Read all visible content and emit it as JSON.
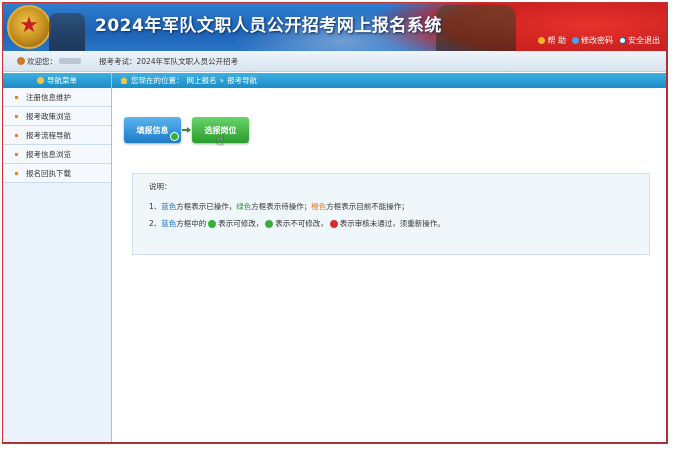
{
  "header": {
    "title": "2024年军队文职人员公开招考网上报名系统",
    "links": [
      {
        "label": "帮 助",
        "icon": "help-icon",
        "color": "#f5b81f"
      },
      {
        "label": "修改密码",
        "icon": "key-icon",
        "color": "#3fa8f0"
      },
      {
        "label": "安全退出",
        "icon": "exit-icon",
        "color": "#ffffff"
      }
    ]
  },
  "infobar": {
    "welcome": "欢迎您：",
    "exam": "报考考试：2024年军队文职人员公开招考"
  },
  "sidebar": {
    "title": "导航菜单",
    "items": [
      {
        "label": "注册信息维护"
      },
      {
        "label": "报考政策浏览"
      },
      {
        "label": "报考流程导航"
      },
      {
        "label": "报考信息浏览"
      },
      {
        "label": "报名回执下载"
      }
    ]
  },
  "breadcrumb": {
    "prefix": "您现在的位置：",
    "section": "网上报名",
    "separator": "»",
    "page": "报考导航"
  },
  "steps": [
    {
      "label": "填报信息",
      "color": "#1e7cc9",
      "status": "completed"
    },
    {
      "label": "选报岗位",
      "color": "#2a9c2c",
      "status": "pending"
    }
  ],
  "notes": {
    "title": "说明：",
    "line1": {
      "num": "1、",
      "blue": "蓝色",
      "t1": "方框表示已操作，",
      "green": "绿色",
      "t2": "方框表示待操作；",
      "orange": "橙色",
      "t3": "方框表示目前不能操作；"
    },
    "line2": {
      "num": "2、",
      "blue": "蓝色",
      "t1": "方框中的",
      "t2": "表示可修改，",
      "t3": "表示不可修改，",
      "t4": "表示审核未通过，须重新操作。"
    }
  },
  "colors": {
    "header_blue": "#1d62b5",
    "accent_blue": "#1a8cc7",
    "done_blue": "#1c6fd0",
    "todo_green": "#2a9c2c",
    "disabled_orange": "#e07b1e"
  }
}
